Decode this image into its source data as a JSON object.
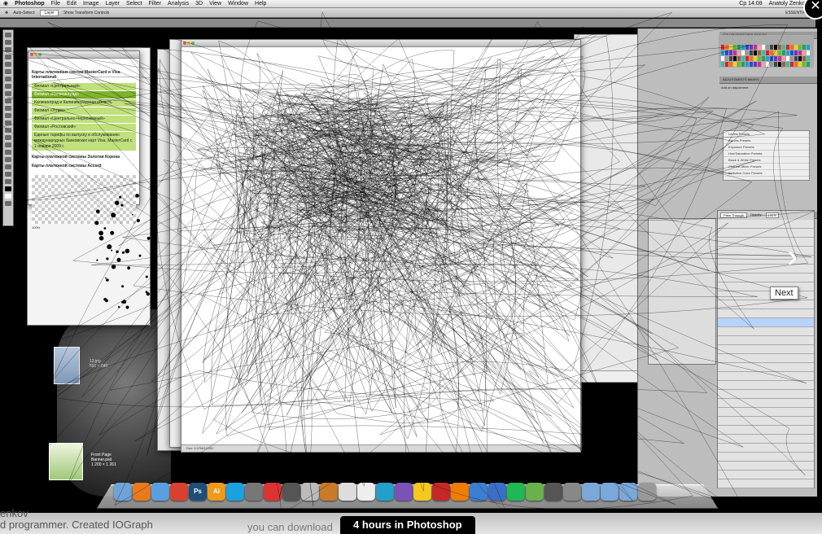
{
  "menubar": {
    "apple": "",
    "app_name": "Photoshop",
    "menus": [
      "File",
      "Edit",
      "Image",
      "Layer",
      "Select",
      "Filter",
      "Analysis",
      "3D",
      "View",
      "Window",
      "Help"
    ],
    "right_items": [
      "Cp 14:08",
      "Anatoly Zenkov"
    ],
    "workspace": "ESSENTIALS"
  },
  "options_bar": {
    "auto_select": "Auto-Select:",
    "layer_select": "Layer",
    "show_transform": "Show Transform Controls"
  },
  "doc_window": {
    "status_text": "Doc: 4.07M/12.0M"
  },
  "browser_window": {
    "heading": "Карты платежных систем MasterCard и Visa International",
    "items": [
      "Филиал «Центральный»",
      "Филиал «Калининград»",
      "Калининград и Калининградская область",
      "Филиал «Углич»",
      "Филиал «Центрально-Черноземный»",
      "Филиал «Ростовский»",
      "Единые тарифы по выпуску и обслуживанию международных банковских карт Visa, MasterCard с 1 января 2009 г."
    ],
    "selected_index": 1,
    "section2": "Карты платежной системы Золотая Корона",
    "section3": "Карты платежной системы Accord",
    "zoom": "100%"
  },
  "panels": {
    "color_tabs": [
      "COLOR",
      "SWATCHES",
      "STYLES"
    ],
    "adjust_tabs": [
      "ADJUSTMENTS",
      "MASKS"
    ],
    "adjust_title": "Add an adjustment",
    "presets": [
      "Levels Presets",
      "Curves Presets",
      "Exposure Presets",
      "Hue/Saturation Presets",
      "Black & White Presets",
      "Channel Mixer Presets",
      "Selective Color Presets"
    ],
    "layer_tabs": [
      "LAYERS",
      "CHANNELS",
      "PATHS"
    ],
    "blend_mode": "Pass Through",
    "opacity_label": "Opacity:",
    "opacity": "100%"
  },
  "desktop": {
    "file1_name": "13.jpg",
    "file1_size": "580 × 840",
    "file2_name": "Front Page Banner.psd",
    "file2_size": "1 200 × 1 261"
  },
  "dock": {
    "apps": [
      "finder-icon",
      "firefox-icon",
      "safari-icon",
      "chrome-icon",
      "photoshop-icon",
      "illustrator-icon",
      "skype-icon",
      "itunes-app-icon",
      "ical-icon",
      "preview-icon",
      "image-capture-icon",
      "iphoto-icon",
      "office-icon",
      "textedit-icon",
      "app1-icon",
      "app2-icon",
      "cyberduck-icon",
      "opera-icon",
      "vlc-icon",
      "itunes-icon",
      "ie-icon",
      "spotify-icon",
      "transmission-icon",
      "automator-icon",
      "trash-stack-icon",
      "folder1-icon",
      "folder2-icon",
      "folder3-icon",
      "trash-icon"
    ]
  },
  "overlay": {
    "caption_title": "4 hours in Photoshop",
    "caption_left_1": "enkov",
    "caption_left_2": "d programmer. Created IOGraph",
    "caption_mid": "you can download",
    "next_tooltip": "Next",
    "close_glyph": "✕",
    "next_glyph": "›"
  },
  "colors": {
    "menubar": "#e4e4e4",
    "accent_green": "#7fb42a",
    "dock_bg": "#bcbcbc",
    "canvas_white": "#ffffff"
  }
}
